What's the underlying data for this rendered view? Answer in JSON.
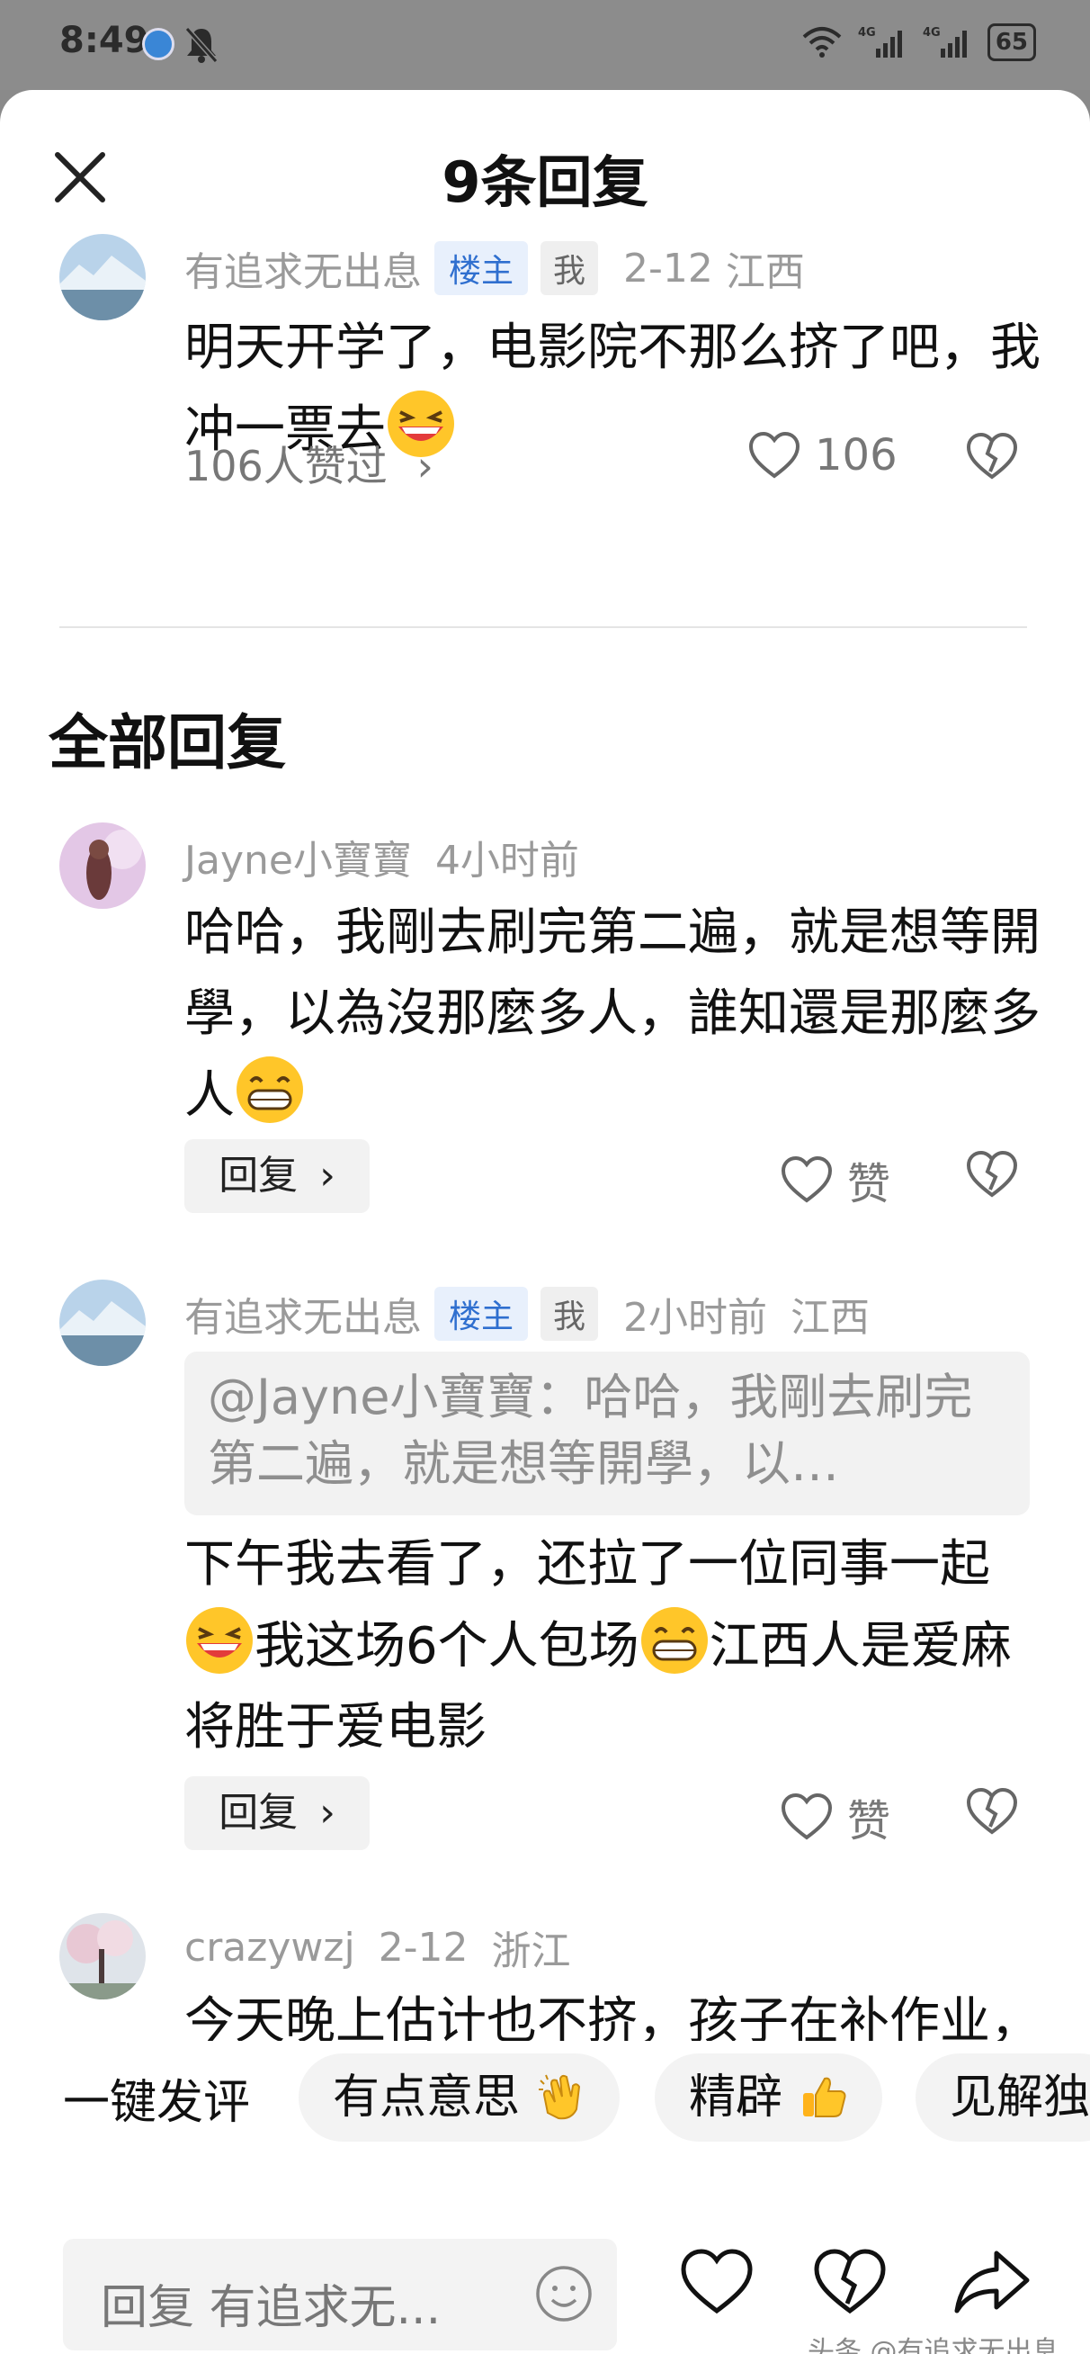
{
  "status_bar": {
    "time": "8:49",
    "battery": "65",
    "net1": "4G",
    "net2": "4G"
  },
  "header": {
    "title": "9条回复"
  },
  "main_comment": {
    "author": "有追求无出息",
    "tag_owner": "楼主",
    "tag_me": "我",
    "date": "2-12",
    "location": "江西",
    "text": "明天开学了，电影院不那么挤了吧，我冲一票去",
    "likes_summary": "106人赞过",
    "like_count": "106"
  },
  "section": {
    "title": "全部回复"
  },
  "replies": [
    {
      "author": "Jayne小寶寶",
      "time": "4小时前",
      "text": "哈哈，我剛去刷完第二遍，就是想等開學，以為沒那麼多人，誰知還是那麼多人",
      "reply_label": "回复",
      "like_label": "赞"
    },
    {
      "author": "有追求无出息",
      "tag_owner": "楼主",
      "tag_me": "我",
      "time": "2小时前",
      "location": "江西",
      "quote": "@Jayne小寶寶：哈哈，我剛去刷完第二遍，就是想等開學，以…",
      "text_part1": "下午我去看了，还拉了一位同事一起",
      "text_part2": "我这场6个人包场",
      "text_part3": "江西人是爱麻将胜于爱电影",
      "reply_label": "回复",
      "like_label": "赞"
    },
    {
      "author": "crazywzj",
      "date": "2-12",
      "location": "浙江",
      "text": "今天晚上估计也不挤，孩子在补作业，家长在旁边坐着"
    }
  ],
  "quick_comment": {
    "label": "一键发评",
    "chips": [
      "有点意思",
      "精辟",
      "见解独"
    ]
  },
  "input": {
    "placeholder": "回复 有追求无..."
  },
  "watermark": "头条 @有追求无出息",
  "icons": {
    "close": "close-icon",
    "like": "heart-icon",
    "dislike": "broken-heart-icon",
    "share": "share-icon",
    "emoji": "smile-icon"
  }
}
